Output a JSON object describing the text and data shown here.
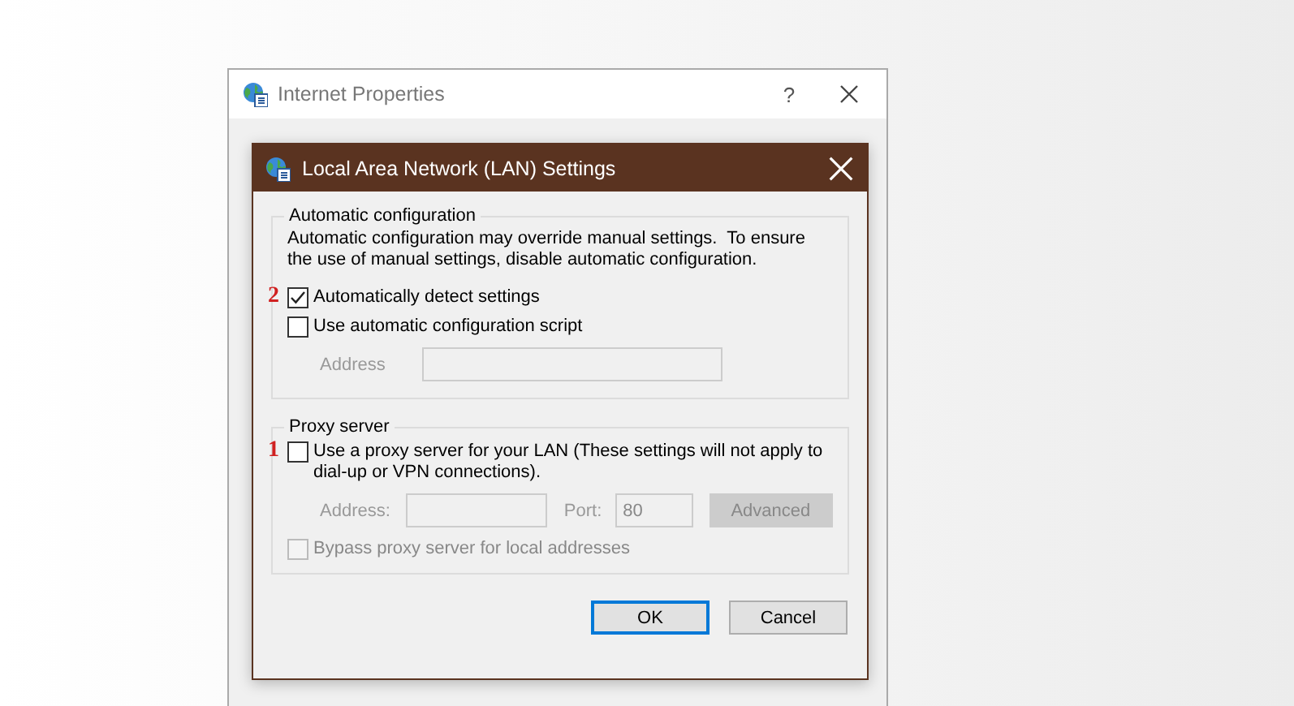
{
  "background_window": {
    "title": "Internet Properties",
    "help": "?"
  },
  "dialog": {
    "title": "Local Area Network (LAN) Settings",
    "groups": [
      {
        "title": "Automatic configuration",
        "description": "Automatic configuration may override manual settings.  To ensure the use of manual settings, disable automatic configuration.",
        "rows": [
          {
            "kind": "checkbox",
            "label": "Automatically detect settings",
            "checked": true,
            "disabled": false,
            "marker": "2"
          },
          {
            "kind": "checkbox",
            "label": "Use automatic configuration script",
            "checked": false,
            "disabled": false
          },
          {
            "kind": "fields",
            "disabled": true,
            "fields": [
              {
                "label": "Address"
              }
            ]
          }
        ]
      },
      {
        "title": "Proxy server",
        "rows": [
          {
            "kind": "checkbox",
            "label": "Use a proxy server for your LAN (These settings will not apply to dial-up or VPN connections).",
            "checked": false,
            "disabled": false,
            "marker": "1"
          },
          {
            "kind": "fields",
            "disabled": true,
            "fields": [
              {
                "label": "Address:"
              },
              {
                "label": "Port:",
                "value": "80"
              }
            ],
            "button": "Advanced"
          },
          {
            "kind": "checkbox",
            "label": "Bypass proxy server for local addresses",
            "checked": false,
            "disabled": true
          }
        ]
      }
    ],
    "buttons": [
      {
        "label": "OK",
        "default": true
      },
      {
        "label": "Cancel",
        "default": false
      }
    ]
  }
}
